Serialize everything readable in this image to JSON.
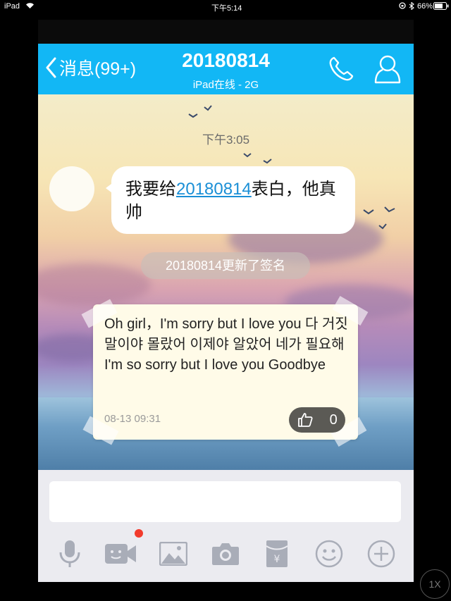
{
  "statusbar": {
    "device": "iPad",
    "time": "下午5:14",
    "battery": "66%"
  },
  "header": {
    "back_label": "消息(99+)",
    "title": "20180814",
    "subtitle": "iPad在线 - 2G"
  },
  "chat": {
    "timestamp": "下午3:05",
    "message": {
      "prefix": "我要给",
      "link": "20180814",
      "suffix": "表白，他真帅"
    },
    "system_notice": "20180814更新了签名",
    "signature_card": {
      "text": "Oh girl，I'm sorry but I love you 다 거짓말이야 몰랐어 이제야 알았어 네가 필요해 I'm so sorry but I love you Goodbye",
      "date": "08-13 09:31",
      "likes": "0"
    }
  },
  "input": {
    "placeholder": ""
  },
  "toolbar": {
    "icons": [
      "microphone-icon",
      "video-icon",
      "image-icon",
      "camera-icon",
      "red-packet-icon",
      "emoji-icon",
      "plus-icon"
    ]
  },
  "overlay": {
    "zoom_label": "1X"
  },
  "colors": {
    "header_bg": "#12b7f5",
    "link": "#1a8fd6",
    "badge_red": "#f23b2c"
  }
}
